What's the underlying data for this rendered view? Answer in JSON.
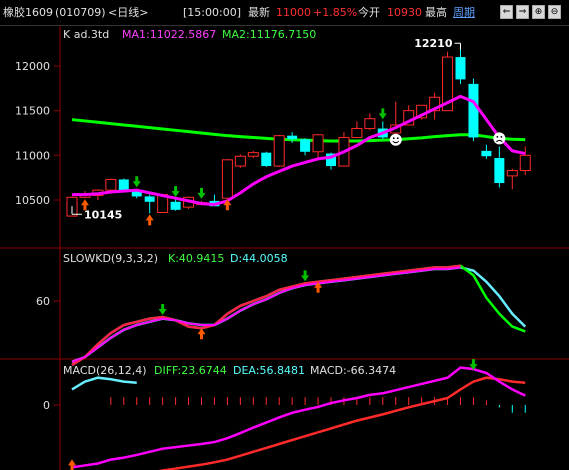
{
  "header": {
    "symbol": "橡胶1609",
    "code": "(010709)",
    "period": "<日线>",
    "time": "[15:00:00]",
    "latest_label": "最新",
    "latest": "11000",
    "change": "+1.85%",
    "open_label": "今开",
    "open": "10930",
    "high_label": "最高",
    "cycle_link": "周期"
  },
  "price_panel": {
    "title": "K ad.3td",
    "ma1": "MA1:11022.5867",
    "ma2": "MA2:11176.7150",
    "ticks": [
      "12000",
      "11500",
      "11000",
      "10500"
    ],
    "high_marker": "12210",
    "low_marker": "10145"
  },
  "kd_panel": {
    "title": "SLOWKD(9,3,3,2)",
    "k": "K:40.9415",
    "d": "D:44.0058",
    "ticks": [
      "60"
    ]
  },
  "macd_panel": {
    "title": "MACD(26,12,4)",
    "diff": "DIFF:23.6744",
    "dea": "DEA:56.8481",
    "macd": "MACD:-66.3474",
    "ticks": [
      "0"
    ]
  },
  "colors": {
    "up": "#ff2a2a",
    "down": "#00ffff",
    "ma1": "#ff00ff",
    "ma2": "#00ff00",
    "arrow_up": "#ff5a00",
    "arrow_down": "#00c000"
  },
  "candles": [
    [
      10320,
      10530,
      10430,
      10540
    ],
    [
      10530,
      10560,
      10520,
      10600
    ],
    [
      10550,
      10610,
      10500,
      10620
    ],
    [
      10610,
      10730,
      10600,
      10740
    ],
    [
      10730,
      10600,
      10590,
      10740
    ],
    [
      10600,
      10540,
      10520,
      10620
    ],
    [
      10540,
      10480,
      10350,
      10560
    ],
    [
      10360,
      10560,
      10360,
      10570
    ],
    [
      10480,
      10390,
      10380,
      10510
    ],
    [
      10420,
      10530,
      10400,
      10540
    ],
    [
      10450,
      10470,
      10440,
      10490
    ],
    [
      10490,
      10430,
      10430,
      10560
    ],
    [
      10520,
      10950,
      10520,
      10960
    ],
    [
      10880,
      10990,
      10860,
      11010
    ],
    [
      10990,
      11030,
      10970,
      11050
    ],
    [
      11030,
      10880,
      10870,
      11040
    ],
    [
      10880,
      11220,
      10870,
      11230
    ],
    [
      11220,
      11180,
      11140,
      11260
    ],
    [
      11180,
      11040,
      11000,
      11190
    ],
    [
      11040,
      11230,
      10960,
      11240
    ],
    [
      11020,
      10880,
      10840,
      11030
    ],
    [
      10880,
      11200,
      10880,
      11260
    ],
    [
      11200,
      11300,
      11200,
      11380
    ],
    [
      11300,
      11410,
      11280,
      11470
    ],
    [
      11300,
      11200,
      11180,
      11380
    ],
    [
      11250,
      11340,
      11260,
      11600
    ],
    [
      11340,
      11500,
      11340,
      11560
    ],
    [
      11420,
      11560,
      11400,
      11560
    ],
    [
      11500,
      11650,
      11400,
      11700
    ],
    [
      11500,
      12100,
      11500,
      12160
    ],
    [
      12100,
      11850,
      11800,
      12210
    ],
    [
      11800,
      11200,
      11160,
      11860
    ],
    [
      11050,
      10990,
      10960,
      11120
    ],
    [
      10970,
      10690,
      10640,
      11100
    ],
    [
      10770,
      10830,
      10620,
      10850
    ],
    [
      10830,
      11000,
      10780,
      11100
    ]
  ],
  "ma1": [
    10560,
    10560,
    10570,
    10590,
    10600,
    10610,
    10580,
    10550,
    10520,
    10490,
    10460,
    10450,
    10490,
    10580,
    10680,
    10760,
    10820,
    10880,
    10920,
    10960,
    10980,
    11040,
    11110,
    11200,
    11250,
    11310,
    11380,
    11450,
    11520,
    11590,
    11660,
    11600,
    11400,
    11200,
    11050,
    11020
  ],
  "ma2": [
    11400,
    11385,
    11370,
    11355,
    11340,
    11325,
    11310,
    11295,
    11280,
    11265,
    11250,
    11235,
    11220,
    11210,
    11200,
    11190,
    11180,
    11175,
    11170,
    11165,
    11160,
    11160,
    11160,
    11165,
    11170,
    11175,
    11185,
    11195,
    11210,
    11220,
    11230,
    11230,
    11210,
    11190,
    11180,
    11176
  ],
  "kd_k": [
    20,
    25,
    33,
    40,
    45,
    47,
    49,
    50,
    48,
    44,
    43,
    45,
    52,
    57,
    60,
    63,
    67,
    69,
    71,
    72,
    73,
    74,
    75,
    76,
    77,
    78,
    79,
    80,
    81,
    81,
    82,
    76,
    62,
    52,
    44,
    41
  ],
  "kd_d": [
    22,
    25,
    31,
    37,
    42,
    45,
    47,
    49,
    48,
    46,
    45,
    45,
    49,
    54,
    58,
    61,
    65,
    68,
    70,
    71,
    72,
    73,
    74,
    75,
    76,
    77,
    78,
    79,
    80,
    80,
    81,
    79,
    72,
    63,
    52,
    44
  ],
  "macd_diff": [
    -160,
    -155,
    -150,
    -140,
    -135,
    -128,
    -120,
    -112,
    -108,
    -104,
    -100,
    -95,
    -85,
    -72,
    -58,
    -45,
    -32,
    -20,
    -12,
    -5,
    5,
    12,
    18,
    26,
    30,
    38,
    46,
    54,
    62,
    70,
    96,
    92,
    82,
    60,
    40,
    24
  ],
  "macd_dea": [
    -200,
    -198,
    -195,
    -190,
    -185,
    -180,
    -174,
    -168,
    -163,
    -158,
    -153,
    -147,
    -140,
    -130,
    -120,
    -110,
    -100,
    -90,
    -80,
    -70,
    -60,
    -50,
    -40,
    -32,
    -24,
    -15,
    -6,
    2,
    10,
    18,
    40,
    60,
    70,
    66,
    60,
    57
  ],
  "arrows_up_price": [
    1,
    6,
    12
  ],
  "arrows_down_price": [
    5,
    8,
    10,
    24
  ],
  "arrows_up_kd": [
    10,
    19
  ],
  "arrows_down_kd": [
    7,
    18
  ],
  "faces": [
    25,
    33
  ]
}
